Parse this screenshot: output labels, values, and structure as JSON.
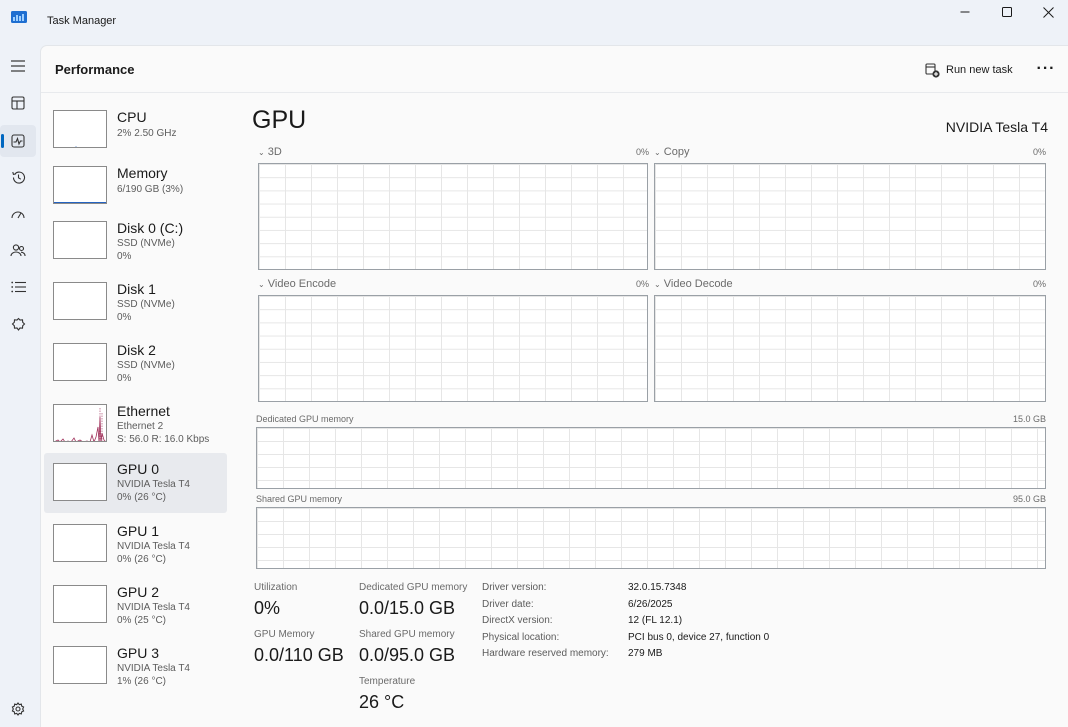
{
  "window": {
    "title": "Task Manager",
    "controls": {
      "minimize": "—",
      "maximize": "☐",
      "close": "✕"
    }
  },
  "nav": {
    "items": [
      {
        "name": "hamburger-menu-icon"
      },
      {
        "name": "processes-icon"
      },
      {
        "name": "performance-icon",
        "active": true
      },
      {
        "name": "app-history-icon"
      },
      {
        "name": "startup-apps-icon"
      },
      {
        "name": "users-icon"
      },
      {
        "name": "details-icon"
      },
      {
        "name": "services-icon"
      },
      {
        "name": "settings-icon"
      }
    ]
  },
  "header": {
    "title": "Performance",
    "run_new_task": "Run new task",
    "more": "···"
  },
  "devices": [
    {
      "name": "CPU",
      "line1": "2% 2.50 GHz",
      "line2": ""
    },
    {
      "name": "Memory",
      "line1": "6/190 GB (3%)",
      "line2": ""
    },
    {
      "name": "Disk 0 (C:)",
      "line1": "SSD (NVMe)",
      "line2": "0%"
    },
    {
      "name": "Disk 1",
      "line1": "SSD (NVMe)",
      "line2": "0%"
    },
    {
      "name": "Disk 2",
      "line1": "SSD (NVMe)",
      "line2": "0%"
    },
    {
      "name": "Ethernet",
      "line1": "Ethernet 2",
      "line2": "S: 56.0 R: 16.0 Kbps"
    },
    {
      "name": "GPU 0",
      "line1": "NVIDIA Tesla T4",
      "line2": "0% (26 °C)",
      "selected": true
    },
    {
      "name": "GPU 1",
      "line1": "NVIDIA Tesla T4",
      "line2": "0% (26 °C)"
    },
    {
      "name": "GPU 2",
      "line1": "NVIDIA Tesla T4",
      "line2": "0% (25 °C)"
    },
    {
      "name": "GPU 3",
      "line1": "NVIDIA Tesla T4",
      "line2": "1% (26 °C)"
    }
  ],
  "detail": {
    "title": "GPU",
    "model": "NVIDIA Tesla T4",
    "engines": [
      {
        "label": "3D",
        "pct": "0%"
      },
      {
        "label": "Copy",
        "pct": "0%"
      },
      {
        "label": "Video Encode",
        "pct": "0%"
      },
      {
        "label": "Video Decode",
        "pct": "0%"
      }
    ],
    "dedicated_memory": {
      "label": "Dedicated GPU memory",
      "max": "15.0 GB"
    },
    "shared_memory": {
      "label": "Shared GPU memory",
      "max": "95.0 GB"
    },
    "stats": {
      "utilization_label": "Utilization",
      "utilization": "0%",
      "gpu_memory_label": "GPU Memory",
      "gpu_memory": "0.0/110 GB",
      "dedicated_label": "Dedicated GPU memory",
      "dedicated": "0.0/15.0 GB",
      "shared_label": "Shared GPU memory",
      "shared": "0.0/95.0 GB",
      "temperature_label": "Temperature",
      "temperature": "26 °C"
    },
    "info": [
      {
        "key": "Driver version:",
        "value": "32.0.15.7348"
      },
      {
        "key": "Driver date:",
        "value": "6/26/2025"
      },
      {
        "key": "DirectX version:",
        "value": "12 (FL 12.1)"
      },
      {
        "key": "Physical location:",
        "value": "PCI bus 0, device 27, function 0"
      },
      {
        "key": "Hardware reserved memory:",
        "value": "279 MB"
      }
    ]
  },
  "colors": {
    "accent": "#0067c0",
    "memory_line": "#2563c0",
    "ethernet_line": "#a0305a"
  }
}
